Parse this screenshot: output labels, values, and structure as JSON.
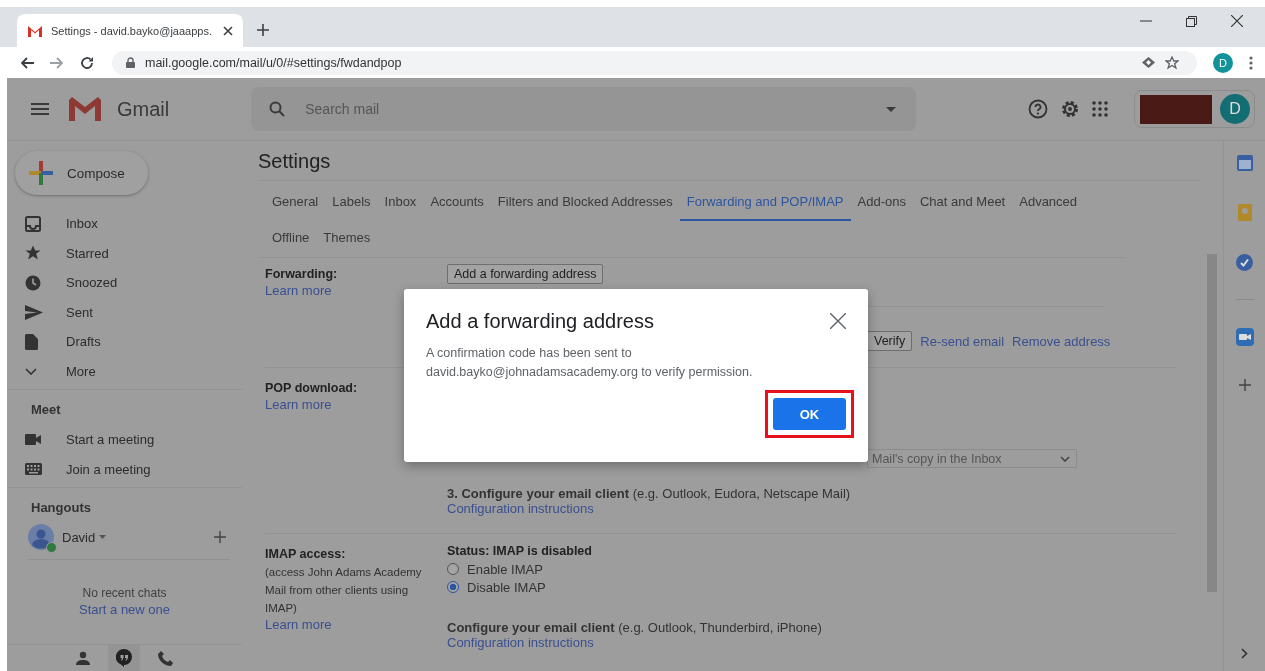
{
  "browser": {
    "tab_title": "Settings - david.bayko@jaaapps.",
    "url": "mail.google.com/mail/u/0/#settings/fwdandpop",
    "profile_initial": "D"
  },
  "header": {
    "app_name": "Gmail",
    "search_placeholder": "Search mail",
    "account_initial": "D"
  },
  "sidebar": {
    "compose": "Compose",
    "items": [
      {
        "label": "Inbox",
        "kind": "inbox"
      },
      {
        "label": "Starred",
        "kind": "star"
      },
      {
        "label": "Snoozed",
        "kind": "clock"
      },
      {
        "label": "Sent",
        "kind": "send"
      },
      {
        "label": "Drafts",
        "kind": "file"
      },
      {
        "label": "More",
        "kind": "chevron"
      }
    ],
    "meet": {
      "title": "Meet",
      "items": [
        {
          "label": "Start a meeting",
          "kind": "camera"
        },
        {
          "label": "Join a meeting",
          "kind": "keyboard"
        }
      ]
    },
    "hangouts": {
      "title": "Hangouts",
      "user": "David",
      "online": true,
      "empty_text": "No recent chats",
      "start_link": "Start a new one"
    }
  },
  "settings": {
    "title": "Settings",
    "tabs": [
      {
        "label": "General",
        "selected": false
      },
      {
        "label": "Labels",
        "selected": false
      },
      {
        "label": "Inbox",
        "selected": false
      },
      {
        "label": "Accounts",
        "selected": false
      },
      {
        "label": "Filters and Blocked Addresses",
        "selected": false
      },
      {
        "label": "Forwarding and POP/IMAP",
        "selected": true
      },
      {
        "label": "Add-ons",
        "selected": false
      },
      {
        "label": "Chat and Meet",
        "selected": false
      },
      {
        "label": "Advanced",
        "selected": false
      },
      {
        "label": "Offline",
        "selected": false
      },
      {
        "label": "Themes",
        "selected": false
      }
    ],
    "forwarding": {
      "label": "Forwarding:",
      "learn_more": "Learn more",
      "add_button": "Add a forwarding address",
      "verify_button": "Verify",
      "links": [
        "Re-send email",
        "Remove address"
      ]
    },
    "pop": {
      "label": "POP download:",
      "learn_more": "Learn more",
      "select_value": "Mail's copy in the Inbox",
      "step": "**3. Configure your email client** (e.g. Outlook, Eudora, Netscape Mail)",
      "config_link": "Configuration instructions"
    },
    "imap": {
      "label": "IMAP access:",
      "note": "(access John Adams Academy Mail from other clients using IMAP)",
      "learn_more": "Learn more",
      "status": "Status: IMAP is disabled",
      "options": [
        {
          "label": "Enable IMAP",
          "selected": false
        },
        {
          "label": "Disable IMAP",
          "selected": true
        }
      ],
      "step": "**Configure your email client** (e.g. Outlook, Thunderbird, iPhone)",
      "config_link": "Configuration instructions"
    }
  },
  "dialog": {
    "title": "Add a forwarding address",
    "message": "A confirmation code has been sent to david.bayko@johnadamsacademy.org to verify permission.",
    "ok": "OK",
    "ok_highlighted": true
  }
}
